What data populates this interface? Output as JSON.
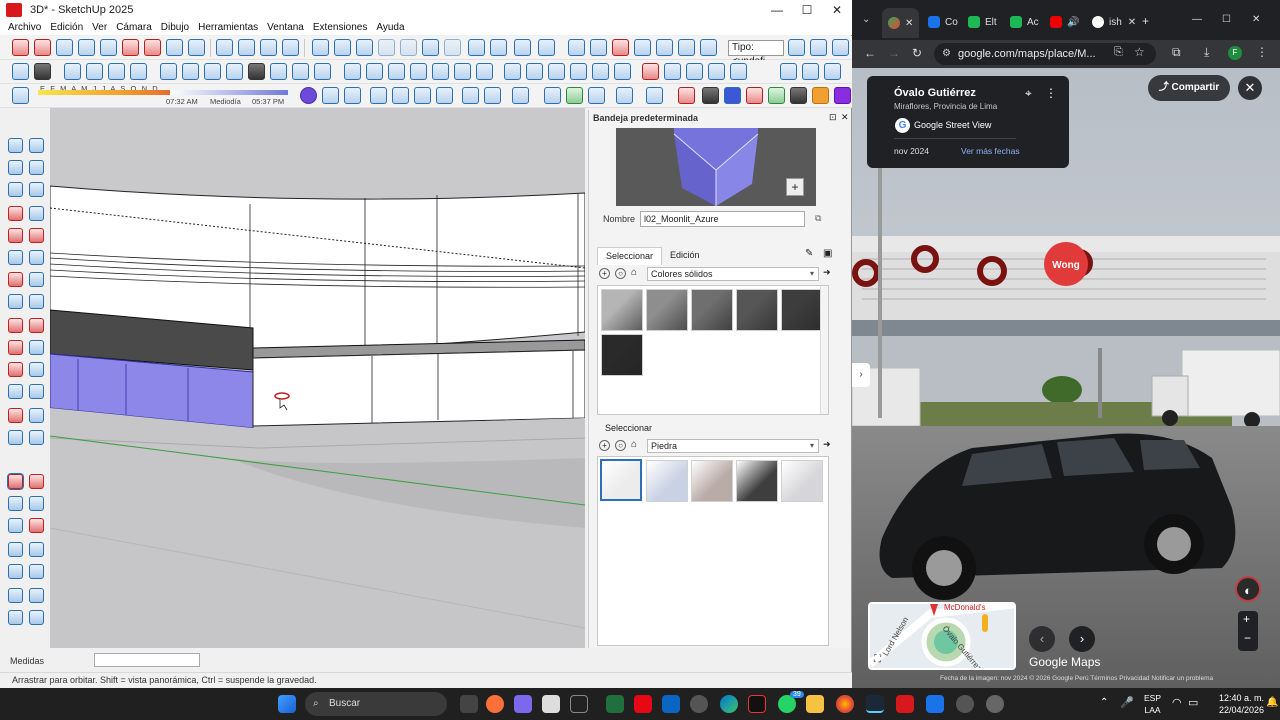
{
  "sketchup": {
    "window_title": "3D* - SketchUp 2025",
    "window_controls": [
      "—",
      "☐",
      "✕"
    ],
    "menu": [
      "Archivo",
      "Edición",
      "Ver",
      "Cámara",
      "Dibujo",
      "Herramientas",
      "Ventana",
      "Extensiones",
      "Ayuda"
    ],
    "type_field": "Tipo: <undefi",
    "shadow": {
      "months": "E F M A M J J A S O N D",
      "time_start": "07:32 AM",
      "time_mid": "Mediodía",
      "time_end": "05:37 PM"
    },
    "tray": {
      "title": "Bandeja predeterminada",
      "name_label": "Nombre",
      "name_value": "l02_Moonlit_Azure",
      "tab_select": "Seleccionar",
      "tab_edit": "Edición",
      "library_1": "Colores sólidos",
      "lower_tab": "Seleccionar",
      "library_2": "Piedra",
      "solid_swatches": [
        "#b5b5b5",
        "#8e8e8e",
        "#6f6f6f",
        "#565656",
        "#3d3d3d",
        "#2a2a2a"
      ],
      "stone_swatches": [
        "#ececec",
        "#c9d2e4",
        "#b9aba6",
        "#3e3e3e",
        "#d6d6da"
      ]
    },
    "measure_label": "Medidas",
    "status_text": "Arrastrar para orbitar. Shift = vista panorámica, Ctrl = suspende la gravedad.",
    "selected_color": "#8c87e8"
  },
  "chrome": {
    "tabs": [
      "Co",
      "Elt",
      "Ac",
      "",
      "ish"
    ],
    "new_tab": "+",
    "url": "google.com/maps/place/M...",
    "window_controls": [
      "—",
      "☐",
      "✕"
    ]
  },
  "maps": {
    "place_title": "Óvalo Gutiérrez",
    "place_sub": "Miraflores, Provincia de Lima",
    "street_view": "Google Street View",
    "date": "nov 2024",
    "more_dates": "Ver más fechas",
    "share": "Compartir",
    "store_sign": "Wong",
    "minimap_labels": {
      "poi": "McDonald's",
      "street1": "Lord Nelson",
      "street2": "Óvalo Gutiérrez"
    },
    "brand": "Google Maps",
    "footer": "Fecha de la imagen: nov 2024   © 2026 Google   Perú   Términos   Privacidad   Notificar un problema"
  },
  "taskbar": {
    "search": "Buscar",
    "lang_1": "ESP",
    "lang_2": "LAA",
    "time": "12:40 a. m.",
    "date": "22/04/2026",
    "badge": "39"
  }
}
